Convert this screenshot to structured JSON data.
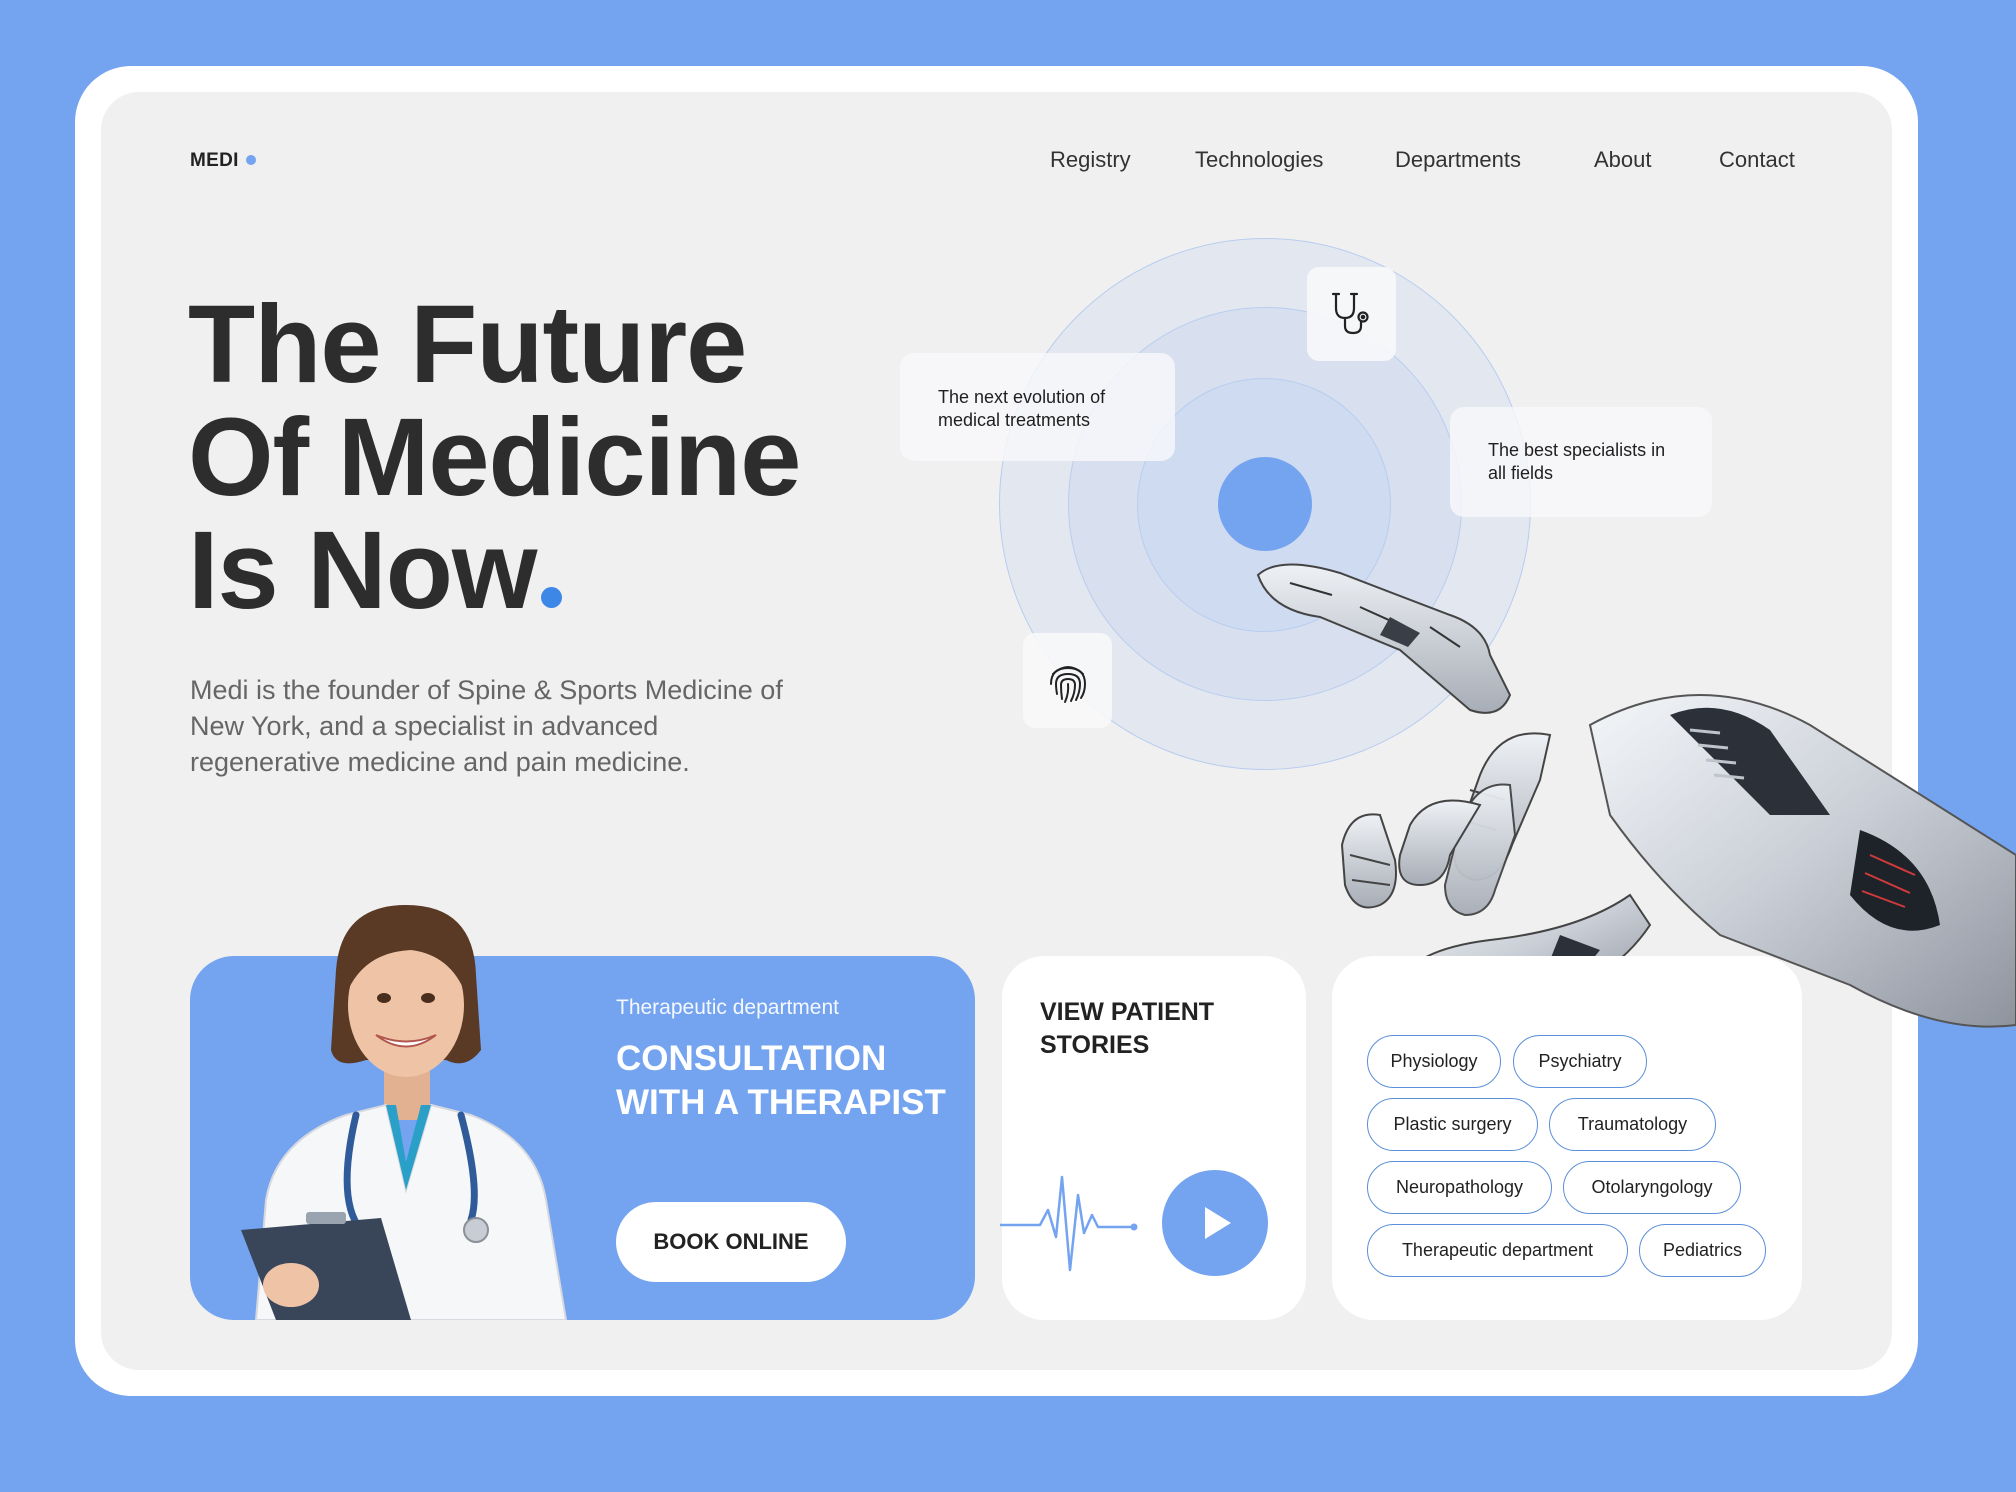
{
  "brand": {
    "logo": "MEDI"
  },
  "nav": {
    "items": [
      "Registry",
      "Technologies",
      "Departments",
      "About",
      "Contact"
    ]
  },
  "hero": {
    "line1": "The Future",
    "line2": "Of Medicine",
    "line3": "Is Now",
    "description": "Medi is the founder of Spine & Sports Medicine of New York, and a specialist in advanced regenerative medicine and pain medicine."
  },
  "tags": {
    "evolution": "The next evolution of medical treatments",
    "specialists": "The best specialists in all fields"
  },
  "icons": {
    "stethoscope": "stethoscope-icon",
    "fingerprint": "fingerprint-icon",
    "play": "play-icon",
    "pulse": "heartbeat-icon"
  },
  "consultation": {
    "subtitle": "Therapeutic department",
    "title": "CONSULTATION WITH A THERAPIST",
    "button": "BOOK ONLINE"
  },
  "stories": {
    "title": "VIEW PATIENT STORIES"
  },
  "departments": {
    "pills": [
      "Physiology",
      "Psychiatry",
      "Plastic surgery",
      "Traumatology",
      "Neuropathology",
      "Otolaryngology",
      "Therapeutic department",
      "Pediatrics"
    ]
  },
  "colors": {
    "accent": "#74a3f0",
    "dot": "#3d87e6",
    "text": "#2d2d2d",
    "panel": "#f0f0f0"
  }
}
